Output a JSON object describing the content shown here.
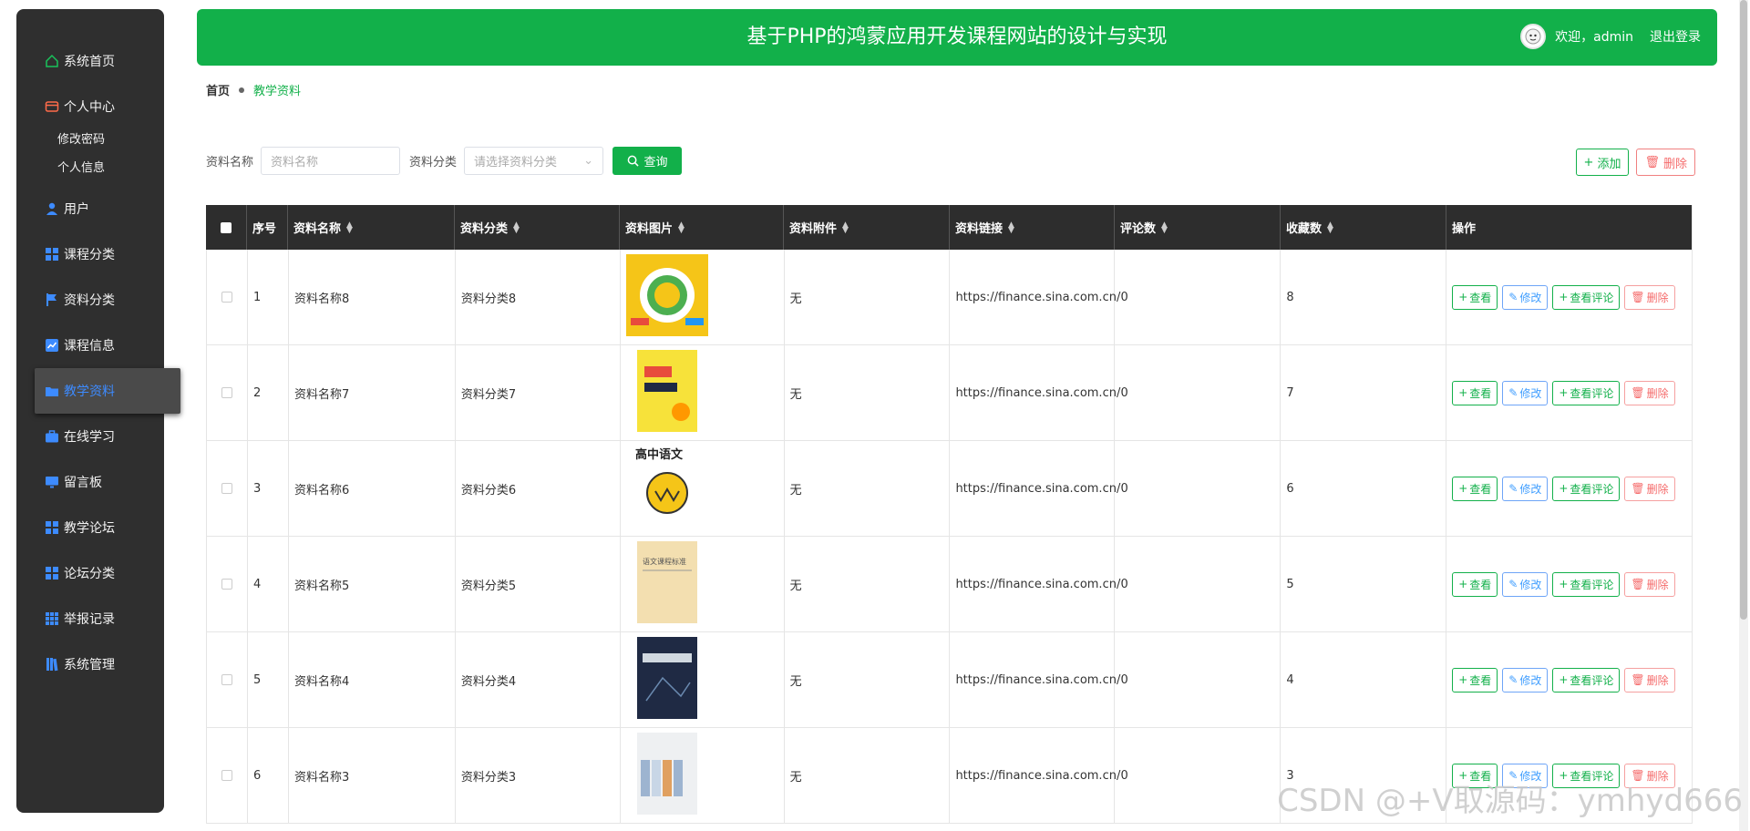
{
  "header": {
    "title": "基于PHP的鸿蒙应用开发课程网站的设计与实现",
    "welcome": "欢迎，admin",
    "logout": "退出登录"
  },
  "sidebar": {
    "items": [
      {
        "label": "系统首页",
        "icon": "home-icon"
      },
      {
        "label": "个人中心",
        "icon": "wallet-icon"
      },
      {
        "label": "用户",
        "icon": "user-icon"
      },
      {
        "label": "课程分类",
        "icon": "grid-icon"
      },
      {
        "label": "资料分类",
        "icon": "flag-icon"
      },
      {
        "label": "课程信息",
        "icon": "chart-icon"
      },
      {
        "label": "教学资料",
        "icon": "folder-icon"
      },
      {
        "label": "在线学习",
        "icon": "briefcase-icon"
      },
      {
        "label": "留言板",
        "icon": "monitor-icon"
      },
      {
        "label": "教学论坛",
        "icon": "grid-icon"
      },
      {
        "label": "论坛分类",
        "icon": "grid-icon"
      },
      {
        "label": "举报记录",
        "icon": "grid9-icon"
      },
      {
        "label": "系统管理",
        "icon": "book-icon"
      }
    ],
    "sub_items": [
      "修改密码",
      "个人信息"
    ],
    "active_index": 6
  },
  "breadcrumb": {
    "home": "首页",
    "current": "教学资料"
  },
  "search": {
    "name_label": "资料名称",
    "name_placeholder": "资料名称",
    "category_label": "资料分类",
    "category_placeholder": "请选择资料分类",
    "query_button": "查询"
  },
  "actions": {
    "add": "添加",
    "delete": "删除"
  },
  "table": {
    "headers": [
      "序号",
      "资料名称",
      "资料分类",
      "资料图片",
      "资料附件",
      "资料链接",
      "评论数",
      "收藏数",
      "操作"
    ],
    "row_actions": {
      "view": "查看",
      "edit": "修改",
      "comments": "查看评论",
      "delete": "删除"
    },
    "rows": [
      {
        "no": "1",
        "name": "资料名称8",
        "category": "资料分类8",
        "attachment": "无",
        "link": "https://finance.sina.com.cn/",
        "comments": "0",
        "favorites": "8",
        "thumb_color": "#f5c518"
      },
      {
        "no": "2",
        "name": "资料名称7",
        "category": "资料分类7",
        "attachment": "无",
        "link": "https://finance.sina.com.cn/",
        "comments": "0",
        "favorites": "7",
        "thumb_color": "#f7e23a"
      },
      {
        "no": "3",
        "name": "资料名称6",
        "category": "资料分类6",
        "attachment": "无",
        "link": "https://finance.sina.com.cn/",
        "comments": "0",
        "favorites": "6",
        "thumb_color": "#ffffff",
        "thumb_text": "高中语文"
      },
      {
        "no": "4",
        "name": "资料名称5",
        "category": "资料分类5",
        "attachment": "无",
        "link": "https://finance.sina.com.cn/",
        "comments": "0",
        "favorites": "5",
        "thumb_color": "#f3dfb0",
        "thumb_text": "语文课程标准"
      },
      {
        "no": "5",
        "name": "资料名称4",
        "category": "资料分类4",
        "attachment": "无",
        "link": "https://finance.sina.com.cn/",
        "comments": "0",
        "favorites": "4",
        "thumb_color": "#1f2a44"
      },
      {
        "no": "6",
        "name": "资料名称3",
        "category": "资料分类3",
        "attachment": "无",
        "link": "https://finance.sina.com.cn/",
        "comments": "0",
        "favorites": "3",
        "thumb_color": "#eef0f2"
      }
    ]
  },
  "watermark": "CSDN @+V取源码：ymhyd666"
}
